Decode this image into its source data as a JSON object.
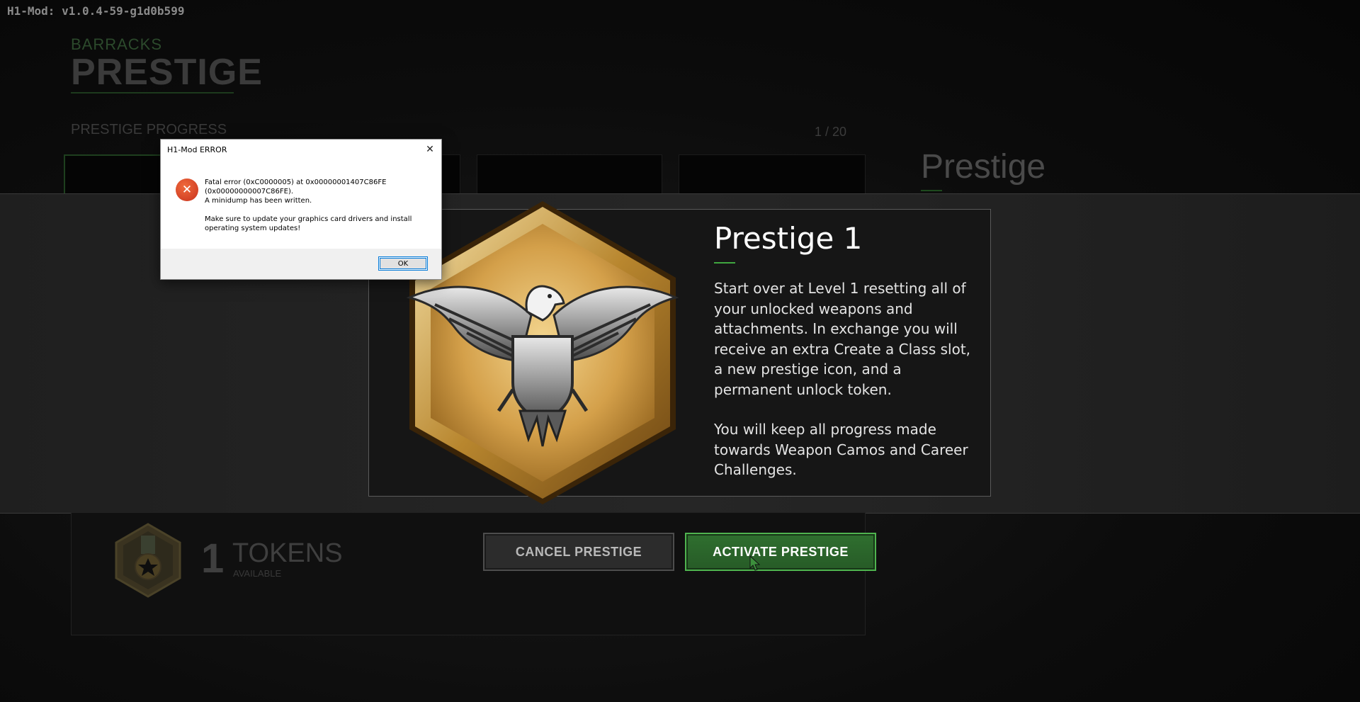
{
  "app": {
    "version": "H1-Mod: v1.0.4-59-g1d0b599"
  },
  "header": {
    "breadcrumb": "BARRACKS",
    "title": "PRESTIGE"
  },
  "progress": {
    "label": "PRESTIGE PROGRESS",
    "counter": "1 / 20"
  },
  "side_panel": {
    "title": "Prestige"
  },
  "modal": {
    "title": "Prestige 1",
    "description_1": "Start over at Level 1 resetting all of your unlocked weapons and attachments. In exchange you will receive an extra Create a Class slot, a new prestige icon, and a permanent unlock token.",
    "description_2": "You will keep all progress made towards Weapon Camos and Career Challenges.",
    "emblem_icon": "eagle-prestige-emblem-icon"
  },
  "tokens": {
    "count": "1",
    "label": "TOKENS",
    "sublabel": "AVAILABLE",
    "icon": "token-medal-icon"
  },
  "buttons": {
    "cancel": "CANCEL PRESTIGE",
    "activate": "ACTIVATE PRESTIGE"
  },
  "error_dialog": {
    "title": "H1-Mod ERROR",
    "close_glyph": "✕",
    "icon": "error-icon",
    "line_1": "Fatal error (0xC0000005) at 0x00000001407C86FE (0x00000000007C86FE).",
    "line_2": "A minidump has been written.",
    "line_3": "Make sure to update your graphics card drivers and install operating system updates!",
    "ok_label": "OK"
  },
  "colors": {
    "accent_green": "#3fa63f",
    "activate_button": "#2f6f2f",
    "dialog_focus_border": "#0078d7",
    "error_red": "#c8321d"
  }
}
